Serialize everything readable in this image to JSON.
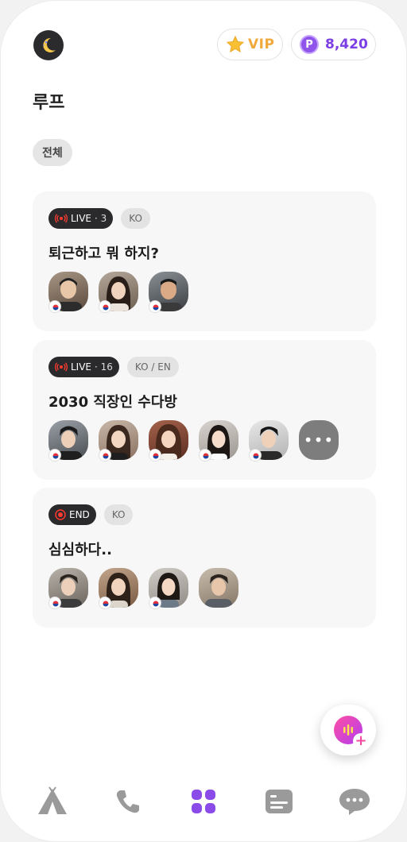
{
  "header": {
    "vip_label": "VIP",
    "points": "8,420",
    "points_icon": "P"
  },
  "page_title": "루프",
  "filter": {
    "selected": "전체"
  },
  "rooms": [
    {
      "status": "LIVE",
      "count": "· 3",
      "lang": "KO",
      "title": "퇴근하고 뭐 하지?",
      "participants": 3
    },
    {
      "status": "LIVE",
      "count": "· 16",
      "lang": "KO / EN",
      "title": "2030 직장인 수다방",
      "participants": 5,
      "more": "•••"
    },
    {
      "status": "END",
      "count": "",
      "lang": "KO",
      "title": "심심하다..",
      "participants": 4
    }
  ],
  "nav": [
    "camp-icon",
    "phone-icon",
    "grid-icon",
    "card-icon",
    "chat-icon"
  ],
  "colors": {
    "accent": "#7b3fe4",
    "vip": "#f2a93b",
    "live_red": "#ff3b30",
    "nav_active": "#8a4be8",
    "nav_inactive": "#9a9a9a"
  }
}
